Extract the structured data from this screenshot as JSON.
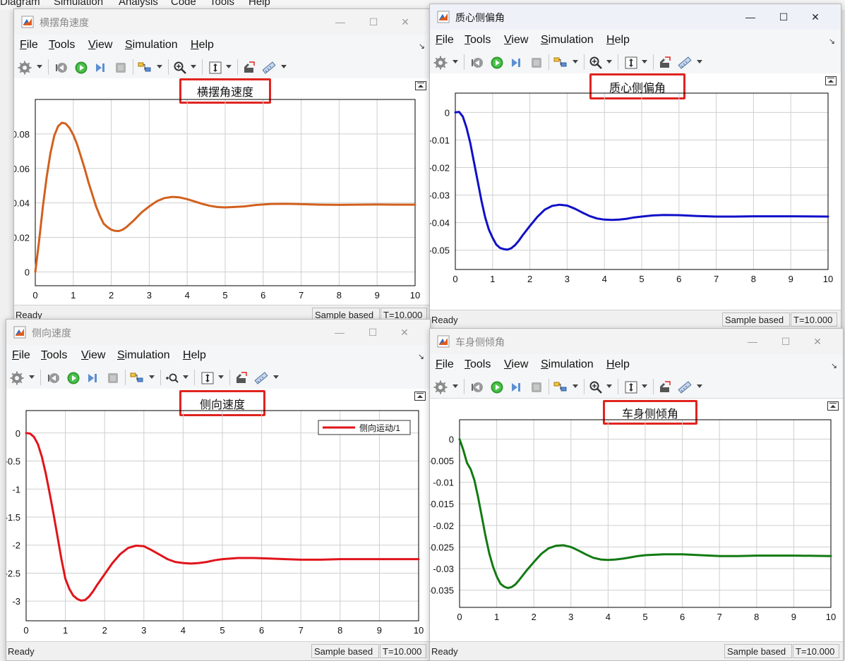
{
  "background_menubar": [
    "Diagram",
    "Simulation",
    "Analysis",
    "Code",
    "Tools",
    "Help"
  ],
  "window_controls": {
    "minimize": "—",
    "maximize": "☐",
    "close": "✕"
  },
  "colors": {
    "highlight_box": "#e0241f",
    "grid": "#cfcfcf",
    "axes": "#000000"
  },
  "windows": [
    {
      "title": "横摆角速度",
      "menu": [
        "File",
        "Tools",
        "View",
        "Simulation",
        "Help"
      ],
      "plot_label": "横摆角速度",
      "status": {
        "ready": "Ready",
        "sample": "Sample based",
        "time": "T=10.000"
      },
      "chart_data": {
        "type": "line",
        "xlim": [
          0,
          10
        ],
        "ylim": [
          -0.008,
          0.1
        ],
        "x_ticks": [
          "0",
          "1",
          "2",
          "3",
          "4",
          "5",
          "6",
          "7",
          "8",
          "9",
          "10"
        ],
        "y_tick_values": [
          0,
          0.02,
          0.04,
          0.06,
          0.08
        ],
        "y_tick_labels": [
          "0",
          "0.02",
          "0.04",
          "0.06",
          "0.08"
        ],
        "grid": true,
        "series": [
          {
            "color": "#d2601e",
            "points": [
              [
                0,
                0
              ],
              [
                0.1,
                0.018
              ],
              [
                0.2,
                0.038
              ],
              [
                0.3,
                0.055
              ],
              [
                0.4,
                0.069
              ],
              [
                0.5,
                0.079
              ],
              [
                0.6,
                0.0845
              ],
              [
                0.7,
                0.0865
              ],
              [
                0.8,
                0.086
              ],
              [
                0.9,
                0.0835
              ],
              [
                1,
                0.0795
              ],
              [
                1.1,
                0.074
              ],
              [
                1.2,
                0.067
              ],
              [
                1.3,
                0.06
              ],
              [
                1.4,
                0.052
              ],
              [
                1.5,
                0.045
              ],
              [
                1.6,
                0.038
              ],
              [
                1.7,
                0.0325
              ],
              [
                1.8,
                0.028
              ],
              [
                1.9,
                0.026
              ],
              [
                2,
                0.0245
              ],
              [
                2.1,
                0.0238
              ],
              [
                2.2,
                0.0237
              ],
              [
                2.3,
                0.0245
              ],
              [
                2.4,
                0.026
              ],
              [
                2.6,
                0.03
              ],
              [
                2.8,
                0.0345
              ],
              [
                3,
                0.038
              ],
              [
                3.2,
                0.041
              ],
              [
                3.4,
                0.0428
              ],
              [
                3.6,
                0.0435
              ],
              [
                3.8,
                0.0432
              ],
              [
                4,
                0.0422
              ],
              [
                4.2,
                0.0408
              ],
              [
                4.4,
                0.0394
              ],
              [
                4.6,
                0.0383
              ],
              [
                4.8,
                0.0376
              ],
              [
                5,
                0.0374
              ],
              [
                5.2,
                0.0376
              ],
              [
                5.5,
                0.038
              ],
              [
                5.8,
                0.0388
              ],
              [
                6.2,
                0.0394
              ],
              [
                6.6,
                0.0395
              ],
              [
                7,
                0.0393
              ],
              [
                7.5,
                0.039
              ],
              [
                8,
                0.0389
              ],
              [
                8.5,
                0.039
              ],
              [
                9,
                0.0391
              ],
              [
                9.5,
                0.039
              ],
              [
                10,
                0.039
              ]
            ]
          }
        ]
      }
    },
    {
      "title": "质心侧偏角",
      "menu": [
        "File",
        "Tools",
        "View",
        "Simulation",
        "Help"
      ],
      "plot_label": "质心侧偏角",
      "status": {
        "ready": "Ready",
        "sample": "Sample based",
        "time": "T=10.000"
      },
      "chart_data": {
        "type": "line",
        "xlim": [
          0,
          10
        ],
        "ylim": [
          -0.057,
          0.007
        ],
        "x_ticks": [
          "0",
          "1",
          "2",
          "3",
          "4",
          "5",
          "6",
          "7",
          "8",
          "9",
          "10"
        ],
        "y_tick_values": [
          0,
          -0.01,
          -0.02,
          -0.03,
          -0.04,
          -0.05
        ],
        "y_tick_labels": [
          "0",
          "-0.01",
          "-0.02",
          "-0.03",
          "-0.04",
          "-0.05"
        ],
        "grid": true,
        "series": [
          {
            "color": "#1010c8",
            "points": [
              [
                0,
                0
              ],
              [
                0.1,
                0.0002
              ],
              [
                0.2,
                -0.0015
              ],
              [
                0.3,
                -0.0055
              ],
              [
                0.4,
                -0.011
              ],
              [
                0.5,
                -0.018
              ],
              [
                0.6,
                -0.025
              ],
              [
                0.7,
                -0.032
              ],
              [
                0.8,
                -0.038
              ],
              [
                0.9,
                -0.0425
              ],
              [
                1,
                -0.0455
              ],
              [
                1.1,
                -0.048
              ],
              [
                1.2,
                -0.0492
              ],
              [
                1.3,
                -0.0496
              ],
              [
                1.4,
                -0.0498
              ],
              [
                1.5,
                -0.0493
              ],
              [
                1.6,
                -0.0482
              ],
              [
                1.7,
                -0.0466
              ],
              [
                1.8,
                -0.0447
              ],
              [
                2,
                -0.0412
              ],
              [
                2.2,
                -0.0379
              ],
              [
                2.4,
                -0.0353
              ],
              [
                2.6,
                -0.0339
              ],
              [
                2.8,
                -0.0335
              ],
              [
                3,
                -0.0338
              ],
              [
                3.2,
                -0.0349
              ],
              [
                3.4,
                -0.0363
              ],
              [
                3.6,
                -0.0376
              ],
              [
                3.8,
                -0.0385
              ],
              [
                4,
                -0.0389
              ],
              [
                4.2,
                -0.039
              ],
              [
                4.4,
                -0.0389
              ],
              [
                4.6,
                -0.0386
              ],
              [
                4.8,
                -0.0381
              ],
              [
                5,
                -0.0378
              ],
              [
                5.3,
                -0.0374
              ],
              [
                5.6,
                -0.0372
              ],
              [
                6,
                -0.0373
              ],
              [
                6.5,
                -0.0376
              ],
              [
                7,
                -0.0378
              ],
              [
                7.5,
                -0.0378
              ],
              [
                8,
                -0.0377
              ],
              [
                9,
                -0.0377
              ],
              [
                10,
                -0.0378
              ]
            ]
          }
        ]
      }
    },
    {
      "title": "侧向速度",
      "menu": [
        "File",
        "Tools",
        "View",
        "Simulation",
        "Help"
      ],
      "plot_label": "侧向速度",
      "legend": "侧向运动/1",
      "status": {
        "ready": "Ready",
        "sample": "Sample based",
        "time": "T=10.000"
      },
      "chart_data": {
        "type": "line",
        "xlim": [
          0,
          10
        ],
        "ylim": [
          -3.35,
          0.4
        ],
        "x_ticks": [
          "0",
          "1",
          "2",
          "3",
          "4",
          "5",
          "6",
          "7",
          "8",
          "9",
          "10"
        ],
        "y_tick_values": [
          0,
          -0.5,
          -1,
          -1.5,
          -2,
          -2.5,
          -3
        ],
        "y_tick_labels": [
          "0",
          "-0.5",
          "-1",
          "-1.5",
          "-2",
          "-2.5",
          "-3"
        ],
        "grid": true,
        "legend_position": "top-right",
        "series": [
          {
            "name": "侧向运动/1",
            "color": "#e0141a",
            "points": [
              [
                0,
                0
              ],
              [
                0.1,
                -0.01
              ],
              [
                0.2,
                -0.07
              ],
              [
                0.3,
                -0.2
              ],
              [
                0.4,
                -0.42
              ],
              [
                0.5,
                -0.72
              ],
              [
                0.6,
                -1.08
              ],
              [
                0.7,
                -1.45
              ],
              [
                0.8,
                -1.85
              ],
              [
                0.9,
                -2.25
              ],
              [
                1,
                -2.6
              ],
              [
                1.1,
                -2.78
              ],
              [
                1.2,
                -2.9
              ],
              [
                1.3,
                -2.96
              ],
              [
                1.4,
                -2.99
              ],
              [
                1.5,
                -2.98
              ],
              [
                1.6,
                -2.92
              ],
              [
                1.7,
                -2.83
              ],
              [
                1.8,
                -2.72
              ],
              [
                2,
                -2.52
              ],
              [
                2.2,
                -2.32
              ],
              [
                2.4,
                -2.16
              ],
              [
                2.6,
                -2.05
              ],
              [
                2.8,
                -2.01
              ],
              [
                3,
                -2.02
              ],
              [
                3.2,
                -2.09
              ],
              [
                3.4,
                -2.17
              ],
              [
                3.6,
                -2.25
              ],
              [
                3.8,
                -2.3
              ],
              [
                4,
                -2.32
              ],
              [
                4.2,
                -2.33
              ],
              [
                4.4,
                -2.32
              ],
              [
                4.6,
                -2.3
              ],
              [
                4.8,
                -2.27
              ],
              [
                5,
                -2.25
              ],
              [
                5.4,
                -2.23
              ],
              [
                5.8,
                -2.23
              ],
              [
                6.2,
                -2.24
              ],
              [
                6.6,
                -2.25
              ],
              [
                7,
                -2.26
              ],
              [
                7.5,
                -2.26
              ],
              [
                8,
                -2.25
              ],
              [
                9,
                -2.25
              ],
              [
                10,
                -2.25
              ]
            ]
          }
        ]
      }
    },
    {
      "title": "车身侧倾角",
      "menu": [
        "File",
        "Tools",
        "View",
        "Simulation",
        "Help"
      ],
      "plot_label": "车身侧倾角",
      "status": {
        "ready": "Ready",
        "sample": "Sample based",
        "time": "T=10.000"
      },
      "chart_data": {
        "type": "line",
        "xlim": [
          0,
          10
        ],
        "ylim": [
          -0.039,
          0.0045
        ],
        "x_ticks": [
          "0",
          "1",
          "2",
          "3",
          "4",
          "5",
          "6",
          "7",
          "8",
          "9",
          "10"
        ],
        "y_tick_values": [
          0,
          -0.005,
          -0.01,
          -0.015,
          -0.02,
          -0.025,
          -0.03,
          -0.035
        ],
        "y_tick_labels": [
          "0",
          "-0.005",
          "-0.01",
          "-0.015",
          "-0.02",
          "-0.025",
          "-0.03",
          "-0.035"
        ],
        "grid": true,
        "series": [
          {
            "color": "#127a12",
            "points": [
              [
                0,
                0
              ],
              [
                0.1,
                -0.0025
              ],
              [
                0.2,
                -0.0055
              ],
              [
                0.3,
                -0.007
              ],
              [
                0.4,
                -0.0095
              ],
              [
                0.5,
                -0.0135
              ],
              [
                0.6,
                -0.018
              ],
              [
                0.7,
                -0.0225
              ],
              [
                0.8,
                -0.0265
              ],
              [
                0.9,
                -0.0295
              ],
              [
                1,
                -0.0318
              ],
              [
                1.1,
                -0.0335
              ],
              [
                1.2,
                -0.0342
              ],
              [
                1.3,
                -0.0345
              ],
              [
                1.4,
                -0.0343
              ],
              [
                1.5,
                -0.0337
              ],
              [
                1.6,
                -0.0327
              ],
              [
                1.8,
                -0.0305
              ],
              [
                2,
                -0.0285
              ],
              [
                2.2,
                -0.0266
              ],
              [
                2.4,
                -0.0253
              ],
              [
                2.6,
                -0.0247
              ],
              [
                2.8,
                -0.0246
              ],
              [
                3,
                -0.025
              ],
              [
                3.2,
                -0.0258
              ],
              [
                3.4,
                -0.0267
              ],
              [
                3.6,
                -0.0275
              ],
              [
                3.8,
                -0.0279
              ],
              [
                4,
                -0.028
              ],
              [
                4.2,
                -0.0279
              ],
              [
                4.4,
                -0.0277
              ],
              [
                4.6,
                -0.0274
              ],
              [
                4.8,
                -0.0271
              ],
              [
                5,
                -0.0269
              ],
              [
                5.5,
                -0.0267
              ],
              [
                6,
                -0.0267
              ],
              [
                6.5,
                -0.0269
              ],
              [
                7,
                -0.0271
              ],
              [
                7.5,
                -0.0271
              ],
              [
                8,
                -0.027
              ],
              [
                9,
                -0.027
              ],
              [
                10,
                -0.0271
              ]
            ]
          }
        ]
      }
    }
  ]
}
